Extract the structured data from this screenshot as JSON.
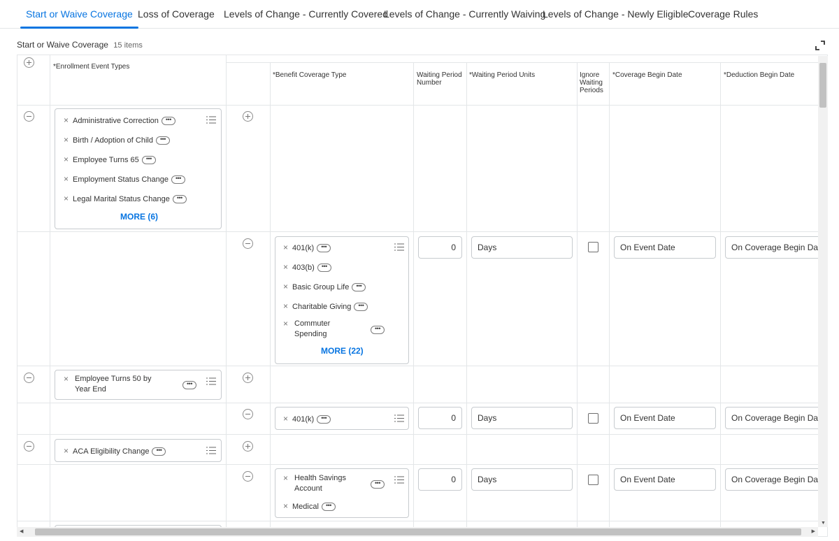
{
  "tabs": [
    {
      "label": "Start or Waive Coverage",
      "active": true
    },
    {
      "label": "Loss of Coverage"
    },
    {
      "label": "Levels of Change - Currently Covered"
    },
    {
      "label": "Levels of Change - Currently Waiving"
    },
    {
      "label": "Levels of Change - Newly Eligible"
    },
    {
      "label": "Coverage Rules"
    }
  ],
  "section": {
    "title": "Start or Waive Coverage",
    "count": "15 items"
  },
  "columns": {
    "enrollment_event_types": "*Enrollment Event Types",
    "benefit_coverage_type": "*Benefit Coverage Type",
    "waiting_period_number_line1": "Waiting Period",
    "waiting_period_number_line2": "Number",
    "waiting_period_units": "*Waiting Period Units",
    "ignore_line1": "Ignore",
    "ignore_line2": "Waiting",
    "ignore_line3": "Periods",
    "coverage_begin_date": "*Coverage Begin Date",
    "deduction_begin_date": "*Deduction Begin Date"
  },
  "groups": [
    {
      "events": [
        "Administrative Correction",
        "Birth / Adoption of Child",
        "Employee Turns 65",
        "Employment Status Change",
        "Legal Marital Status Change"
      ],
      "events_more": "MORE (6)",
      "coverage": {
        "types": [
          "401(k)",
          "403(b)",
          "Basic Group Life",
          "Charitable Giving",
          "Commuter Spending"
        ],
        "types_more": "MORE (22)",
        "waiting_number": "0",
        "waiting_units": "Days",
        "ignore": false,
        "coverage_begin": "On Event Date",
        "deduction_begin": "On Coverage Begin Date"
      }
    },
    {
      "events": [
        "Employee Turns 50 by Year End"
      ],
      "coverage": {
        "types": [
          "401(k)"
        ],
        "waiting_number": "0",
        "waiting_units": "Days",
        "ignore": false,
        "coverage_begin": "On Event Date",
        "deduction_begin": "On Coverage Begin Date"
      }
    },
    {
      "events": [
        "ACA Eligibility Change"
      ],
      "coverage": {
        "types": [
          "Health Savings Account",
          "Medical"
        ],
        "waiting_number": "0",
        "waiting_units": "Days",
        "ignore": false,
        "coverage_begin": "On Event Date",
        "deduction_begin": "On Coverage Begin Date"
      }
    }
  ],
  "icons": {
    "add": "add-circle-icon",
    "remove": "remove-circle-icon",
    "related_actions": "ellipsis-icon",
    "list": "list-icon",
    "remove_item": "x-icon",
    "expand": "expand-icon"
  },
  "colors": {
    "accent": "#0875e1",
    "border": "#c7cbcf",
    "grid": "#e3e6e8"
  }
}
